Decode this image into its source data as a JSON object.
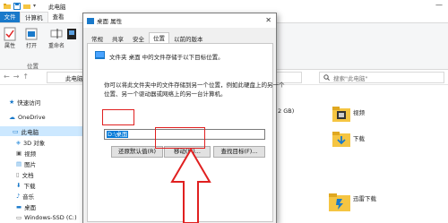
{
  "explorer": {
    "window_title": "此电脑",
    "tabs": [
      "文件",
      "计算机",
      "查看"
    ],
    "ribbon": {
      "buttons": [
        "属性",
        "打开",
        "重命名"
      ],
      "group_label": "位置"
    },
    "address": "此电脑",
    "search_placeholder": "搜索\"此电脑\"",
    "sidebar": {
      "quick_access": "快速访问",
      "onedrive": "OneDrive",
      "this_pc": "此电脑",
      "objects_3d": "3D 对象",
      "videos": "视频",
      "pictures": "图片",
      "documents": "文档",
      "downloads": "下载",
      "music": "音乐",
      "desktop": "桌面",
      "drive_c": "Windows-SSD (C:)"
    },
    "content": {
      "partial_label": "2 GB)",
      "folders": {
        "videos": "视频",
        "downloads": "下载",
        "xunlei": "迅雷下载"
      }
    }
  },
  "dialog": {
    "title": "桌面 属性",
    "tabs": [
      "常规",
      "共享",
      "安全",
      "位置",
      "以前的版本"
    ],
    "active_tab": "位置",
    "line1": "文件夹 桌面 中的文件存储于以下目标位置。",
    "desc_lines": [
      "你可以将此文件夹中的文件存储到另一个位置，例如此硬盘上的另一个",
      "位置、另一个驱动器或网络上的另一台计算机。"
    ],
    "path_value": "D:\\桌面",
    "buttons": {
      "restore": "还原默认值(R)",
      "move": "移动(M)...",
      "find": "查找目标(F)..."
    }
  },
  "colors": {
    "accent": "#1979ca",
    "selection": "#0078d7",
    "highlight_box": "#e02020",
    "folder_yellow": "#f5c542"
  }
}
